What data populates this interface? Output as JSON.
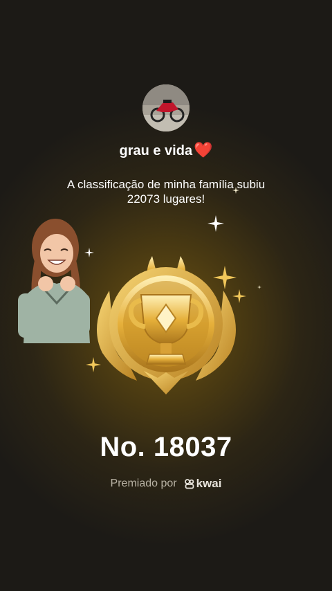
{
  "profile": {
    "username": "grau e vida",
    "heart": "❤️"
  },
  "message": {
    "line1": "A classificação de minha família subiu",
    "line2": "22073 lugares!"
  },
  "rank": {
    "label": "No. 18037"
  },
  "footer": {
    "awarded_by": "Premiado por",
    "brand": "kwai"
  },
  "icons": [
    "avatar-motorcycle-photo",
    "girl-sticker",
    "trophy-badge-icon",
    "sparkle-icon",
    "kwai-logo-icon"
  ],
  "colors": {
    "gold": "#e3b23c",
    "heart": "#e01e2e",
    "text": "#ffffff",
    "muted": "#b8b2a4"
  }
}
